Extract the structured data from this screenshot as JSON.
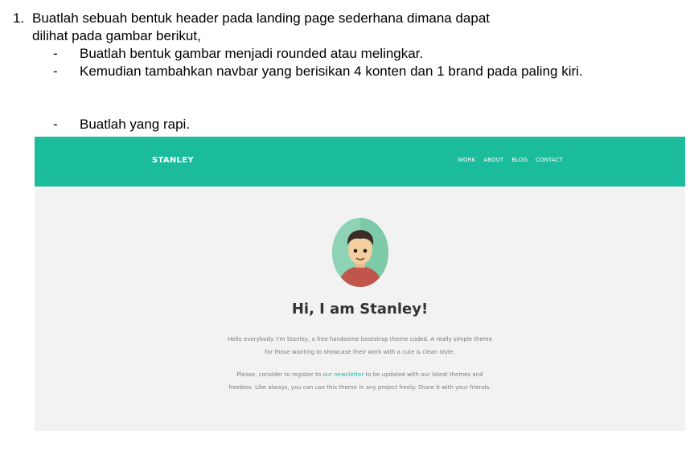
{
  "task": {
    "number": "1.",
    "line1": "Buatlah sebuah bentuk header pada landing page sederhana dimana dapat",
    "line2": "dilihat pada gambar berikut,",
    "bullets": [
      {
        "dash": "-",
        "text": "Buatlah bentuk gambar menjadi rounded atau melingkar."
      },
      {
        "dash": "-",
        "text": "Kemudian tambahkan navbar yang berisikan 4 konten dan 1 brand pada paling kiri."
      },
      {
        "dash": "-",
        "text": "Buatlah yang rapi."
      }
    ]
  },
  "landing": {
    "brand": "STANLEY",
    "nav": [
      "WORK",
      "ABOUT",
      "BLOG",
      "CONTACT"
    ],
    "avatar_icon": "avatar-icon",
    "title": "Hi, I am Stanley!",
    "para1_line1": "Hello everybody. I'm Stanley, a free handsome bootstrap theme coded. A really simple theme",
    "para1_line2": "for those wanting to showcase their work with a cute & clean style.",
    "para2_before": "Please, consider to register to ",
    "para2_link": "our newsletter",
    "para2_after": " to be updated with our latest themes and",
    "para2_line2": "freebies. Like always, you can use this theme in any project freely. Share it with your friends.",
    "colors": {
      "navbar": "#1abc9c",
      "background": "#f2f2f2"
    }
  }
}
